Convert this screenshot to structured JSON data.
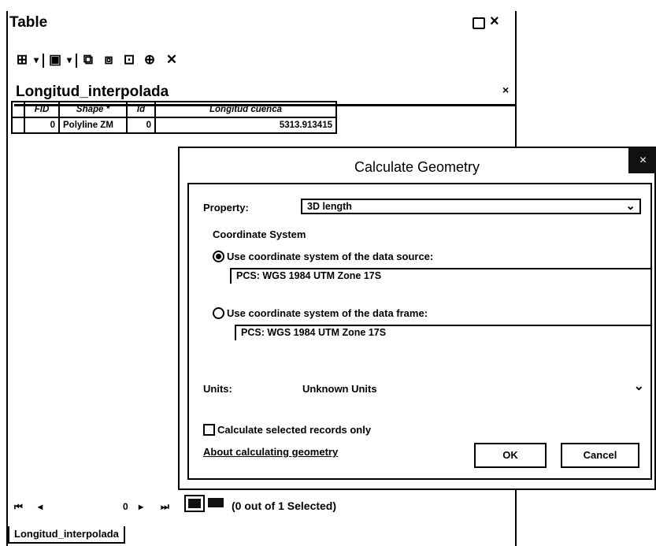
{
  "window": {
    "title": "Table",
    "restore_icon": "restore-icon",
    "close_label": "×"
  },
  "toolbar": {
    "icons": [
      "table-options-icon",
      "related-tables-icon",
      "select-by-attributes-icon",
      "switch-selection-icon",
      "clear-selection-icon",
      "zoom-to-selected-icon",
      "delete-selected-icon"
    ],
    "options_glyph": "⊞",
    "related_glyph": "▣",
    "select_glyph": "⧉",
    "switch_glyph": "⧈",
    "clear_glyph": "⊡",
    "zoom_glyph": "⊕",
    "delete_glyph": "✕",
    "dropdown_glyph": "▾"
  },
  "tab": {
    "name": "Longitud_interpolada",
    "close_label": "×"
  },
  "grid": {
    "headers": [
      "FID",
      "Shape *",
      "Id",
      "Longitud cuenca"
    ],
    "rows": [
      {
        "fid": "0",
        "shape": "Polyline ZM",
        "id": "0",
        "longitud": "5313.913415"
      }
    ]
  },
  "dialog": {
    "title": "Calculate Geometry",
    "close_label": "×",
    "property_label": "Property:",
    "property_value": "3D length",
    "coord_system_label": "Coordinate System",
    "use_source_label": "Use coordinate system of the data source:",
    "source_cs": "PCS: WGS 1984 UTM Zone 17S",
    "use_frame_label": "Use coordinate system of the data frame:",
    "frame_cs": "PCS: WGS 1984 UTM Zone 17S",
    "units_label": "Units:",
    "units_value": "Unknown Units",
    "selected_only_label": "Calculate selected records only",
    "about_link": "About calculating geometry",
    "ok_label": "OK",
    "cancel_label": "Cancel",
    "dropdown_glyph": "⌄"
  },
  "footer": {
    "first_glyph": "⏮",
    "prev_glyph": "◂",
    "page_number": "0",
    "next_glyph": "▸",
    "last_glyph": "⏭",
    "selection_text": "(0 out of 1 Selected)",
    "bottom_tab": "Longitud_interpolada"
  }
}
